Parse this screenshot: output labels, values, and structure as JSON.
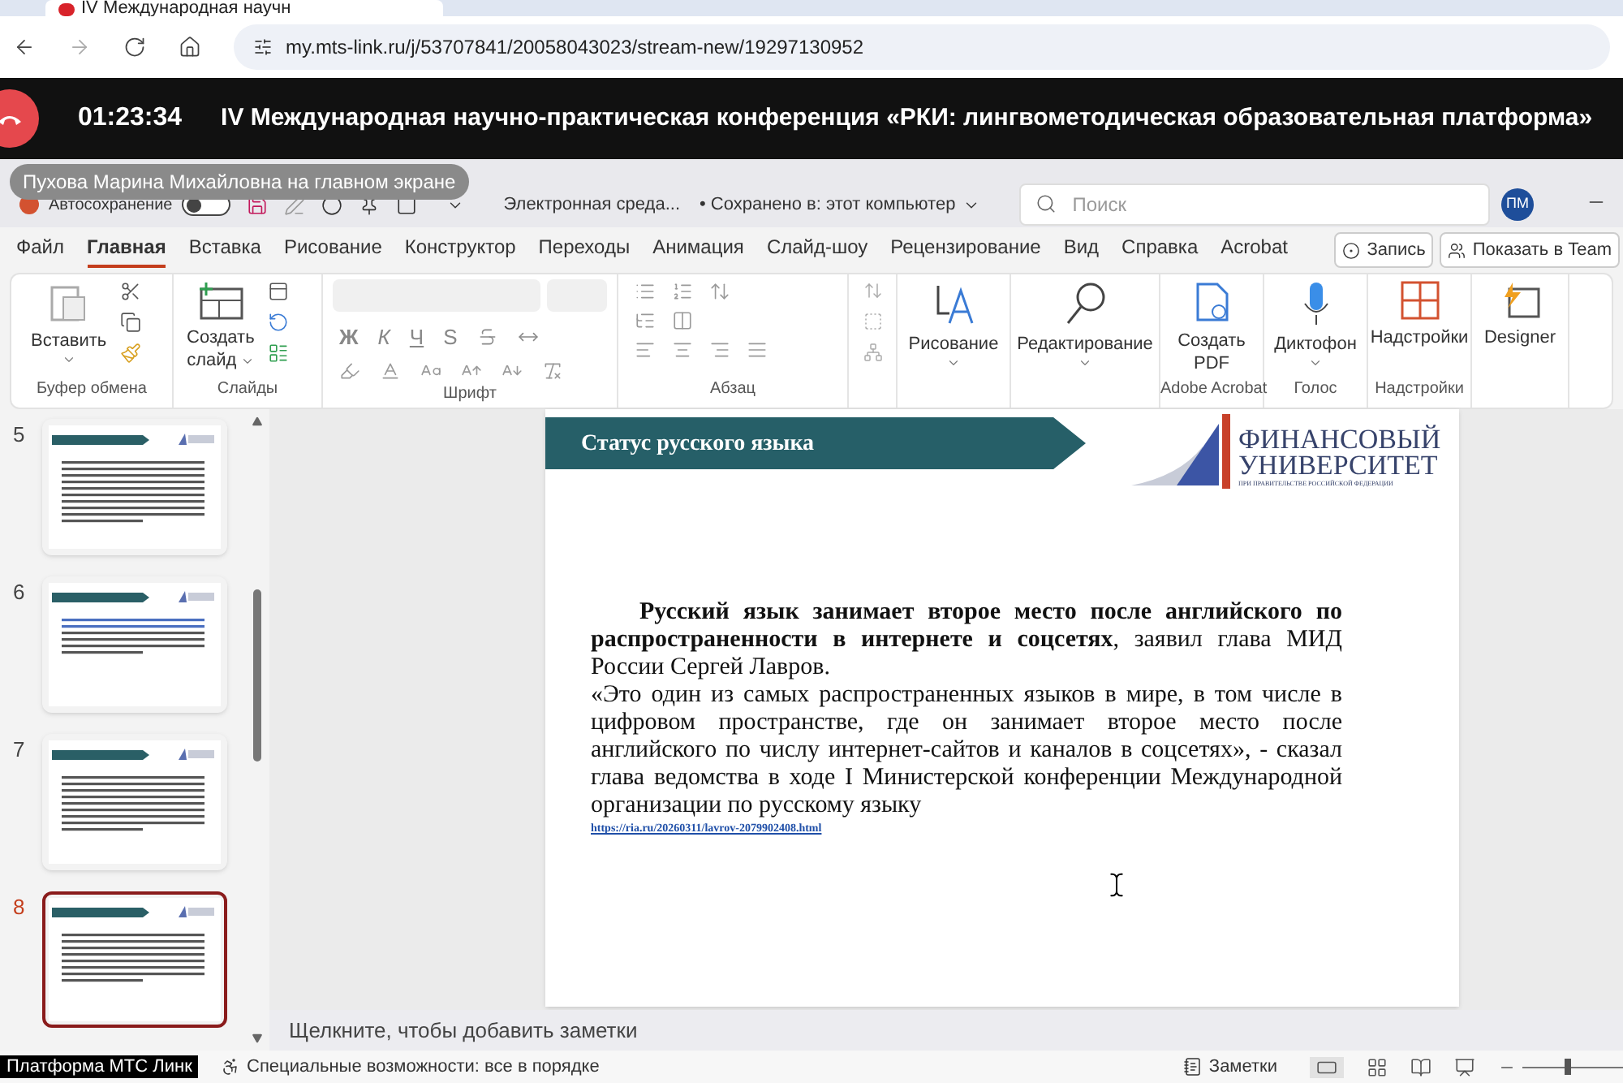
{
  "browser": {
    "tab_title": "IV Международная научн",
    "url": "my.mts-link.ru/j/53707841/20058043023/stream-new/19297130952"
  },
  "conference": {
    "time": "01:23:34",
    "title": "IV Международная научно-практическая конференция «РКИ: лингвометодическая образовательная платформа»",
    "presenter": "Пухова Марина Михайловна на главном экране"
  },
  "title_bar": {
    "autosave": "Автосохранение",
    "autosave_on": false,
    "document": "Электронная среда...",
    "saved": "• Сохранено в: этот компьютер",
    "search_placeholder": "Поиск",
    "avatar": "ПМ"
  },
  "ribbon_tabs": [
    {
      "label": "Файл",
      "selected": false
    },
    {
      "label": "Главная",
      "selected": true
    },
    {
      "label": "Вставка",
      "selected": false
    },
    {
      "label": "Рисование",
      "selected": false
    },
    {
      "label": "Конструктор",
      "selected": false
    },
    {
      "label": "Переходы",
      "selected": false
    },
    {
      "label": "Анимация",
      "selected": false
    },
    {
      "label": "Слайд-шоу",
      "selected": false
    },
    {
      "label": "Рецензирование",
      "selected": false
    },
    {
      "label": "Вид",
      "selected": false
    },
    {
      "label": "Справка",
      "selected": false
    },
    {
      "label": "Acrobat",
      "selected": false
    }
  ],
  "ribbon_buttons": [
    "Запись",
    "Показать в Team"
  ],
  "ribbon": {
    "paste": "Вставить",
    "new_slide_1": "Создать",
    "new_slide_2": "слайд",
    "format": [
      "Ж",
      "К",
      "Ч",
      "S"
    ],
    "drawing": "Рисование",
    "editing": "Редактирование",
    "pdf_1": "Создать",
    "pdf_2": "PDF",
    "dictate": "Диктофон",
    "addins": "Надстройки",
    "designer": "Designer",
    "groups": [
      "Буфер обмена",
      "Слайды",
      "Шрифт",
      "Абзац",
      "Adobe Acrobat",
      "Голос",
      "Надстройки"
    ]
  },
  "slides": [
    {
      "number": "5",
      "selected": false
    },
    {
      "number": "6",
      "selected": false
    },
    {
      "number": "7",
      "selected": false
    },
    {
      "number": "8",
      "selected": true
    }
  ],
  "slide": {
    "title": "Статус русского языка",
    "logo_1": "ФИНАНСОВЫЙ",
    "logo_2": "УНИВЕРСИТЕТ",
    "logo_3": "ПРИ ПРАВИТЕЛЬСТВЕ РОССИЙСКОЙ ФЕДЕРАЦИИ",
    "paragraphs": [
      "**Русский язык занимает второе место после английского по распространенности в интернете и соцсетях**, заявил глава МИД России Сергей Лавров.",
      "«Это один из самых распространенных языков в мире, в том числе в цифровом пространстве, где он занимает второе место после английского по числу интернет-сайтов и каналов в соцсетях», - сказал глава ведомства в ходе I Министерской конференции Международной организации по русскому языку"
    ],
    "link": "https://ria.ru/20260311/lavrov-2079902408.html"
  },
  "notes_placeholder": "Щелкните, чтобы добавить заметки",
  "status_bar": {
    "tooltip": "Платформа МТС Линк",
    "accessibility": "Специальные возможности: все в порядке",
    "notes": "Заметки",
    "zoom": {
      "level": 0.45
    }
  }
}
